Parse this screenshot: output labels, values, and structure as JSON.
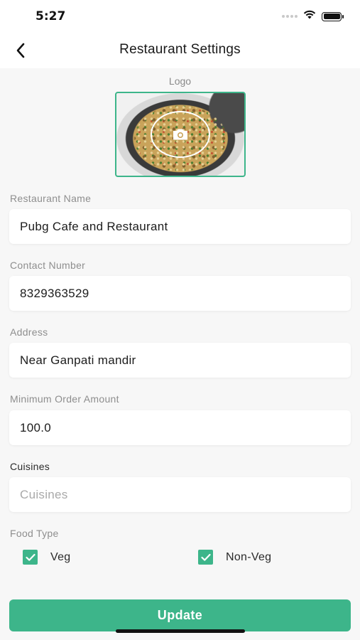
{
  "status_bar": {
    "time": "5:27",
    "signal_icon": "signal-dots-icon",
    "wifi_icon": "wifi-icon",
    "battery_icon": "battery-icon"
  },
  "nav": {
    "back_icon": "chevron-left-icon",
    "title": "Restaurant Settings"
  },
  "logo": {
    "label": "Logo",
    "camera_icon": "camera-icon"
  },
  "fields": {
    "restaurant_name": {
      "label": "Restaurant Name",
      "value": "Pubg Cafe and Restaurant"
    },
    "contact_number": {
      "label": "Contact Number",
      "value": "8329363529"
    },
    "address": {
      "label": "Address",
      "value": "Near Ganpati mandir"
    },
    "min_order": {
      "label": "Minimum Order Amount",
      "value": "100.0"
    },
    "cuisines": {
      "label": "Cuisines",
      "placeholder": "Cuisines",
      "value": ""
    }
  },
  "food_type": {
    "label": "Food Type",
    "options": [
      {
        "label": "Veg",
        "checked": true
      },
      {
        "label": "Non-Veg",
        "checked": true
      }
    ]
  },
  "update_button": {
    "label": "Update"
  },
  "colors": {
    "accent": "#3db58a",
    "background": "#f7f7f7",
    "field_bg": "#ffffff"
  }
}
